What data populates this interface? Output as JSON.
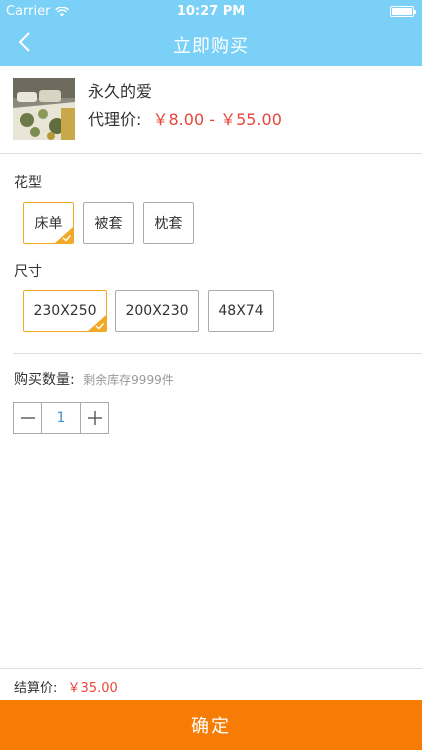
{
  "status_bar": {
    "carrier": "Carrier",
    "time": "10:27 PM"
  },
  "nav": {
    "title": "立即购买"
  },
  "product": {
    "name": "永久的爱",
    "price_label": "代理价:",
    "price_range": "￥8.00 - ￥55.00"
  },
  "pattern": {
    "label": "花型",
    "options": [
      "床单",
      "被套",
      "枕套"
    ],
    "selected": "床单"
  },
  "size": {
    "label": "尺寸",
    "options": [
      "230X250",
      "200X230",
      "48X74"
    ],
    "selected": "230X250"
  },
  "quantity": {
    "label": "购买数量:",
    "stock": "剩余库存9999件",
    "value": "1"
  },
  "total": {
    "label": "结算价:",
    "value": "￥35.00"
  },
  "confirm": {
    "label": "确定"
  },
  "colors": {
    "header": "#7ad0f6",
    "price": "#e8463c",
    "selected_border": "#f3a928",
    "confirm": "#f77c06"
  }
}
